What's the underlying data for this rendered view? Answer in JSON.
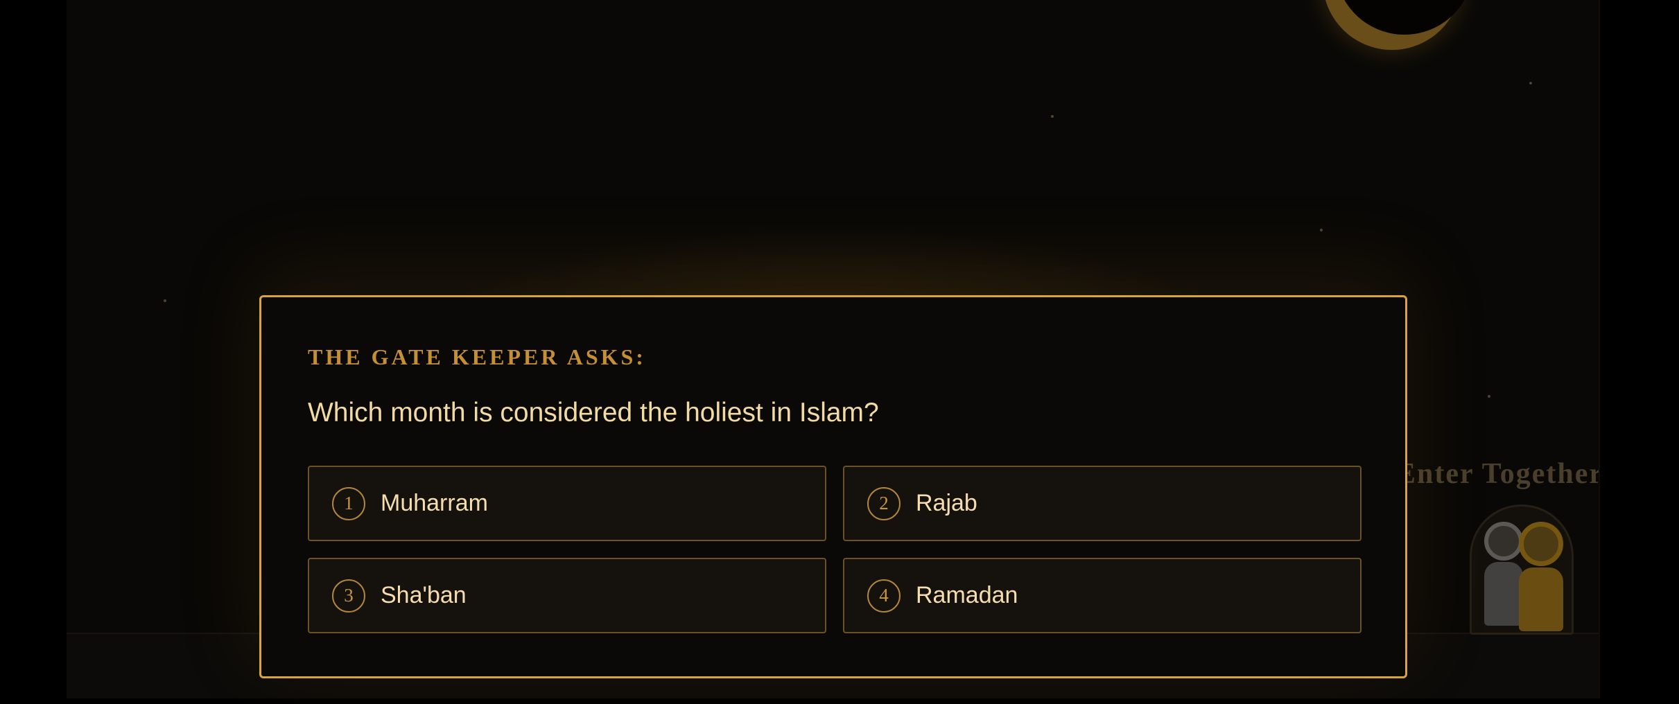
{
  "scene": {
    "sign_text": "Enter Together",
    "moon_icon": "crescent-moon-icon",
    "accent_color": "#d9a43f",
    "background_color": "#090806"
  },
  "quiz": {
    "heading": "The Gate Keeper asks:",
    "question": "Which month is considered the holiest in Islam?",
    "options": [
      {
        "number": "1",
        "label": "Muharram"
      },
      {
        "number": "2",
        "label": "Rajab"
      },
      {
        "number": "3",
        "label": "Sha'ban"
      },
      {
        "number": "4",
        "label": "Ramadan"
      }
    ]
  }
}
